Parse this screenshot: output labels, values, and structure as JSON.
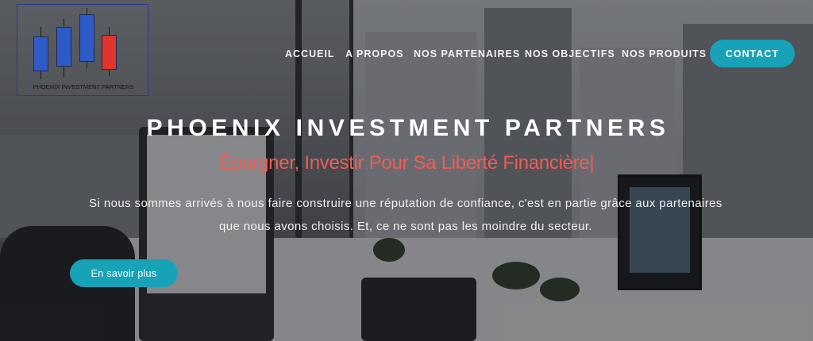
{
  "logo": {
    "text": "PHOENIX INVESTMENT PARTNERS",
    "colors": {
      "up": "#2e5bc7",
      "down": "#e0352b"
    }
  },
  "nav": {
    "items": [
      {
        "label": "ACCUEIL"
      },
      {
        "label": "A PROPOS"
      },
      {
        "label": "NOS PARTENAIRES"
      },
      {
        "label": "NOS OBJECTIFS"
      },
      {
        "label": "NOS PRODUITS"
      }
    ],
    "contact_label": "CONTACT"
  },
  "hero": {
    "title": "PHOENIX INVESTMENT PARTNERS",
    "tagline": "Épargner, Investir Pour Sa Liberté Financière|",
    "description": "Si nous sommes arrivés à nous faire construire une réputation de confiance, c'est en partie grâce aux partenaires que nous avons choisis. Et, ce ne sont pas les moindre du secteur.",
    "cta_label": "En savoir plus"
  },
  "theme": {
    "accent": "#17a2b8",
    "tagline_color": "#f25c54"
  }
}
